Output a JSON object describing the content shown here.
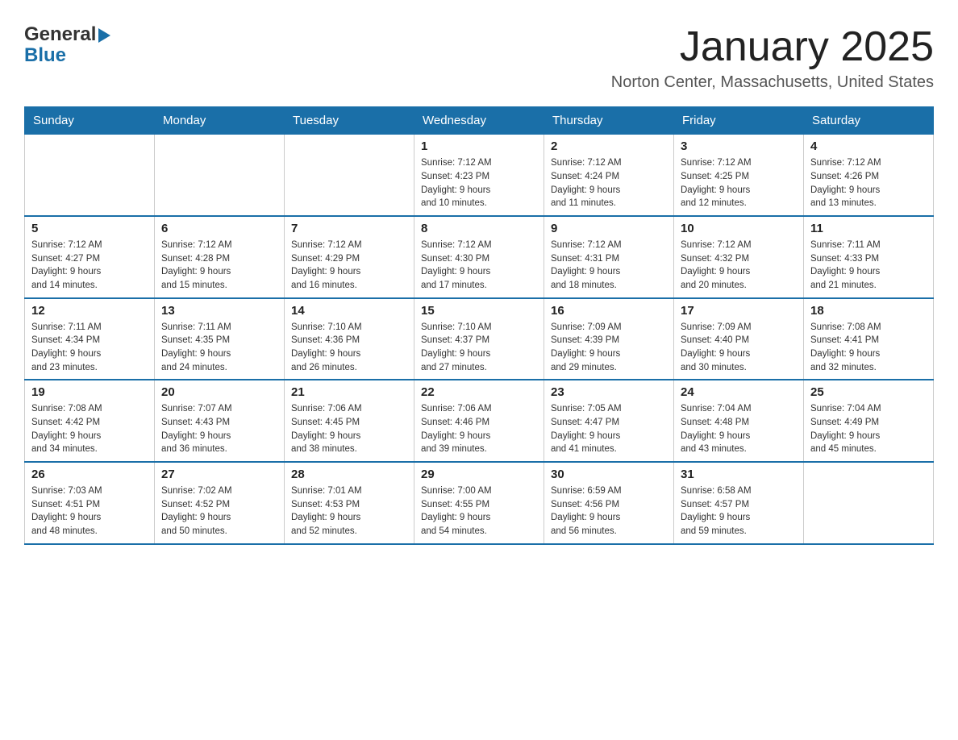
{
  "header": {
    "logo_general": "General",
    "logo_blue": "Blue",
    "month_title": "January 2025",
    "location": "Norton Center, Massachusetts, United States"
  },
  "days_of_week": [
    "Sunday",
    "Monday",
    "Tuesday",
    "Wednesday",
    "Thursday",
    "Friday",
    "Saturday"
  ],
  "weeks": [
    [
      {
        "day": "",
        "info": ""
      },
      {
        "day": "",
        "info": ""
      },
      {
        "day": "",
        "info": ""
      },
      {
        "day": "1",
        "info": "Sunrise: 7:12 AM\nSunset: 4:23 PM\nDaylight: 9 hours\nand 10 minutes."
      },
      {
        "day": "2",
        "info": "Sunrise: 7:12 AM\nSunset: 4:24 PM\nDaylight: 9 hours\nand 11 minutes."
      },
      {
        "day": "3",
        "info": "Sunrise: 7:12 AM\nSunset: 4:25 PM\nDaylight: 9 hours\nand 12 minutes."
      },
      {
        "day": "4",
        "info": "Sunrise: 7:12 AM\nSunset: 4:26 PM\nDaylight: 9 hours\nand 13 minutes."
      }
    ],
    [
      {
        "day": "5",
        "info": "Sunrise: 7:12 AM\nSunset: 4:27 PM\nDaylight: 9 hours\nand 14 minutes."
      },
      {
        "day": "6",
        "info": "Sunrise: 7:12 AM\nSunset: 4:28 PM\nDaylight: 9 hours\nand 15 minutes."
      },
      {
        "day": "7",
        "info": "Sunrise: 7:12 AM\nSunset: 4:29 PM\nDaylight: 9 hours\nand 16 minutes."
      },
      {
        "day": "8",
        "info": "Sunrise: 7:12 AM\nSunset: 4:30 PM\nDaylight: 9 hours\nand 17 minutes."
      },
      {
        "day": "9",
        "info": "Sunrise: 7:12 AM\nSunset: 4:31 PM\nDaylight: 9 hours\nand 18 minutes."
      },
      {
        "day": "10",
        "info": "Sunrise: 7:12 AM\nSunset: 4:32 PM\nDaylight: 9 hours\nand 20 minutes."
      },
      {
        "day": "11",
        "info": "Sunrise: 7:11 AM\nSunset: 4:33 PM\nDaylight: 9 hours\nand 21 minutes."
      }
    ],
    [
      {
        "day": "12",
        "info": "Sunrise: 7:11 AM\nSunset: 4:34 PM\nDaylight: 9 hours\nand 23 minutes."
      },
      {
        "day": "13",
        "info": "Sunrise: 7:11 AM\nSunset: 4:35 PM\nDaylight: 9 hours\nand 24 minutes."
      },
      {
        "day": "14",
        "info": "Sunrise: 7:10 AM\nSunset: 4:36 PM\nDaylight: 9 hours\nand 26 minutes."
      },
      {
        "day": "15",
        "info": "Sunrise: 7:10 AM\nSunset: 4:37 PM\nDaylight: 9 hours\nand 27 minutes."
      },
      {
        "day": "16",
        "info": "Sunrise: 7:09 AM\nSunset: 4:39 PM\nDaylight: 9 hours\nand 29 minutes."
      },
      {
        "day": "17",
        "info": "Sunrise: 7:09 AM\nSunset: 4:40 PM\nDaylight: 9 hours\nand 30 minutes."
      },
      {
        "day": "18",
        "info": "Sunrise: 7:08 AM\nSunset: 4:41 PM\nDaylight: 9 hours\nand 32 minutes."
      }
    ],
    [
      {
        "day": "19",
        "info": "Sunrise: 7:08 AM\nSunset: 4:42 PM\nDaylight: 9 hours\nand 34 minutes."
      },
      {
        "day": "20",
        "info": "Sunrise: 7:07 AM\nSunset: 4:43 PM\nDaylight: 9 hours\nand 36 minutes."
      },
      {
        "day": "21",
        "info": "Sunrise: 7:06 AM\nSunset: 4:45 PM\nDaylight: 9 hours\nand 38 minutes."
      },
      {
        "day": "22",
        "info": "Sunrise: 7:06 AM\nSunset: 4:46 PM\nDaylight: 9 hours\nand 39 minutes."
      },
      {
        "day": "23",
        "info": "Sunrise: 7:05 AM\nSunset: 4:47 PM\nDaylight: 9 hours\nand 41 minutes."
      },
      {
        "day": "24",
        "info": "Sunrise: 7:04 AM\nSunset: 4:48 PM\nDaylight: 9 hours\nand 43 minutes."
      },
      {
        "day": "25",
        "info": "Sunrise: 7:04 AM\nSunset: 4:49 PM\nDaylight: 9 hours\nand 45 minutes."
      }
    ],
    [
      {
        "day": "26",
        "info": "Sunrise: 7:03 AM\nSunset: 4:51 PM\nDaylight: 9 hours\nand 48 minutes."
      },
      {
        "day": "27",
        "info": "Sunrise: 7:02 AM\nSunset: 4:52 PM\nDaylight: 9 hours\nand 50 minutes."
      },
      {
        "day": "28",
        "info": "Sunrise: 7:01 AM\nSunset: 4:53 PM\nDaylight: 9 hours\nand 52 minutes."
      },
      {
        "day": "29",
        "info": "Sunrise: 7:00 AM\nSunset: 4:55 PM\nDaylight: 9 hours\nand 54 minutes."
      },
      {
        "day": "30",
        "info": "Sunrise: 6:59 AM\nSunset: 4:56 PM\nDaylight: 9 hours\nand 56 minutes."
      },
      {
        "day": "31",
        "info": "Sunrise: 6:58 AM\nSunset: 4:57 PM\nDaylight: 9 hours\nand 59 minutes."
      },
      {
        "day": "",
        "info": ""
      }
    ]
  ]
}
